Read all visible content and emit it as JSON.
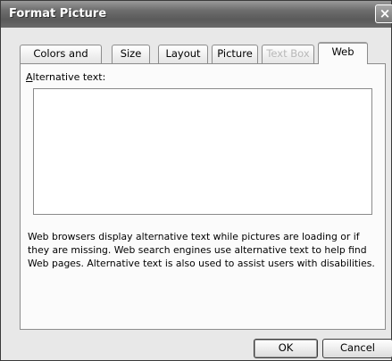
{
  "window": {
    "title": "Format Picture",
    "close_label": "×"
  },
  "tabs": [
    {
      "label": "Colors and Lines",
      "state": "normal"
    },
    {
      "label": "Size",
      "state": "normal"
    },
    {
      "label": "Layout",
      "state": "normal"
    },
    {
      "label": "Picture",
      "state": "normal"
    },
    {
      "label": "Text Box",
      "state": "disabled"
    },
    {
      "label": "Web",
      "state": "active"
    }
  ],
  "web_tab": {
    "alt_label_accel": "A",
    "alt_label_rest": "lternative text:",
    "alt_text_value": "",
    "help_text": "Web browsers display alternative text while pictures are loading or if they are missing.  Web search engines use alternative text to help find Web pages.  Alternative text is also used to assist users with disabilities."
  },
  "buttons": {
    "ok": "OK",
    "cancel": "Cancel"
  }
}
